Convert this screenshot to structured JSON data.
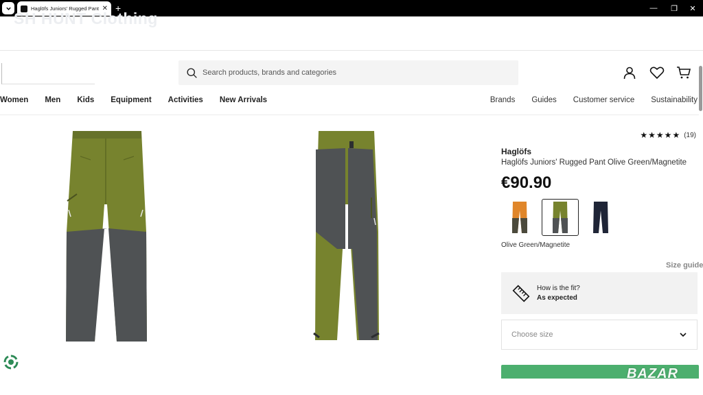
{
  "browser": {
    "tab_title": "Haglöfs Juniors' Rugged Pant Ol",
    "tab_close": "✕",
    "new_tab": "+",
    "minimize": "—",
    "restore": "❐",
    "close": "✕"
  },
  "site": {
    "brand_ghost": "SH HUNT Clothing"
  },
  "search": {
    "placeholder": "Search products, brands and categories"
  },
  "nav": {
    "left": [
      "Women",
      "Men",
      "Kids",
      "Equipment",
      "Activities",
      "New Arrivals"
    ],
    "right": [
      "Brands",
      "Guides",
      "Customer service",
      "Sustainability"
    ]
  },
  "product": {
    "stars": "★★★★★",
    "rating": 5,
    "review_count": "(19)",
    "brand": "Haglöfs",
    "name": "Haglöfs Juniors' Rugged Pant Olive Green/Magnetite",
    "price": "€90.90",
    "selected_color": "Olive Green/Magnetite",
    "colors": [
      "orange",
      "olive-green",
      "navy"
    ],
    "size_guide": "Size guide",
    "fit_question": "How is the fit?",
    "fit_answer": "As expected",
    "size_placeholder": "Choose size"
  },
  "colors": {
    "olive": "#77832e",
    "magnetite": "#4f5254",
    "orange": "#e0862a",
    "navy": "#1f2537",
    "add_button": "#4caf6e"
  },
  "watermark": "BAZAR"
}
